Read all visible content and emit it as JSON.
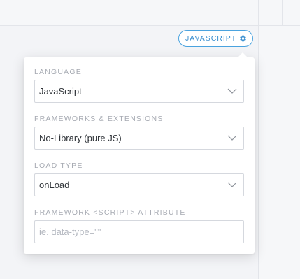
{
  "header": {
    "language_pill": {
      "label": "JAVASCRIPT",
      "icon": "gear-icon",
      "accent_color": "#3a8fd0"
    }
  },
  "panel": {
    "language": {
      "label": "LANGUAGE",
      "value": "JavaScript",
      "icon": "chevron-down-icon"
    },
    "frameworks": {
      "label": "FRAMEWORKS & EXTENSIONS",
      "value": "No-Library (pure JS)",
      "icon": "chevron-down-icon"
    },
    "load_type": {
      "label": "LOAD TYPE",
      "value": "onLoad",
      "icon": "chevron-down-icon"
    },
    "script_attribute": {
      "label": "FRAMEWORK <SCRIPT> ATTRIBUTE",
      "value": "",
      "placeholder": "ie. data-type=\"\""
    }
  }
}
